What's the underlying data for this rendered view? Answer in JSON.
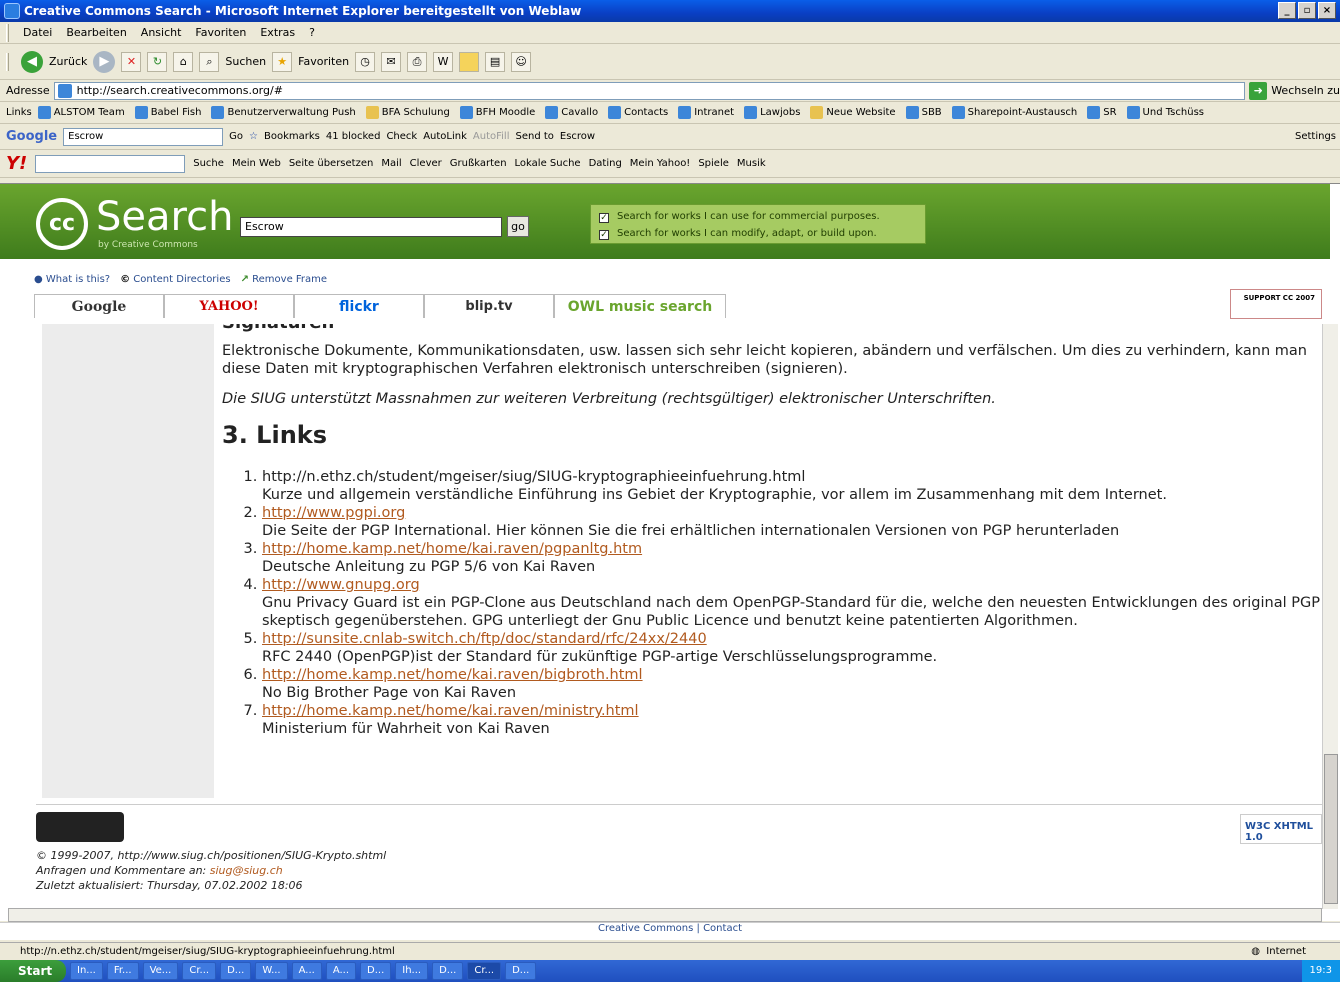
{
  "window": {
    "title": "Creative Commons Search - Microsoft Internet Explorer bereitgestellt von Weblaw"
  },
  "menu": [
    "Datei",
    "Bearbeiten",
    "Ansicht",
    "Favoriten",
    "Extras",
    "?"
  ],
  "toolbar": {
    "back": "Zurück",
    "search": "Suchen",
    "favorites": "Favoriten"
  },
  "address": {
    "label": "Adresse",
    "url": "http://search.creativecommons.org/#",
    "go": "Wechseln zu"
  },
  "links": {
    "label": "Links",
    "items": [
      "ALSTOM Team",
      "Babel Fish",
      "Benutzerverwaltung Push",
      "BFA Schulung",
      "BFH Moodle",
      "Cavallo",
      "Contacts",
      "Intranet",
      "Lawjobs",
      "Neue Website",
      "SBB",
      "Sharepoint-Austausch",
      "SR",
      "Und Tschüss"
    ]
  },
  "google_bar": {
    "brand": "Google",
    "query": "Escrow",
    "go": "Go",
    "bookmarks": "Bookmarks",
    "blocked": "41 blocked",
    "check": "Check",
    "autolink": "AutoLink",
    "autofill": "AutoFill",
    "send": "Send to",
    "escrow": "Escrow",
    "settings": "Settings"
  },
  "yahoo_bar": {
    "suche": "Suche",
    "items": [
      "Mein Web",
      "Seite übersetzen",
      "Mail",
      "Clever",
      "Grußkarten",
      "Lokale Suche",
      "Dating",
      "Mein Yahoo!",
      "Spiele",
      "Musik"
    ]
  },
  "cc": {
    "search_word": "Search",
    "by": "by Creative Commons",
    "query": "Escrow",
    "go": "go",
    "opt1": "Search for works I can use for commercial purposes.",
    "opt2": "Search for works I can modify, adapt, or build upon.",
    "what": "What is this?",
    "directories": "Content Directories",
    "remove": "Remove Frame",
    "tabs": [
      "Google",
      "YAHOO!",
      "flickr",
      "blip.tv",
      "OWL music search"
    ],
    "support": "SUPPORT CC 2007"
  },
  "content": {
    "h3": "Signaturen",
    "p1": "Elektronische Dokumente, Kommunikationsdaten, usw. lassen sich sehr leicht kopieren, abändern und verfälschen. Um dies zu verhindern, kann man diese Daten mit kryptographischen Verfahren elektronisch unterschreiben (signieren).",
    "p2": "Die SIUG unterstützt Massnahmen zur weiteren Verbreitung (rechtsgültiger) elektronischer Unterschriften.",
    "h2": "3. Links",
    "links": [
      {
        "url": "http://n.ethz.ch/student/mgeiser/siug/SIUG-kryptographieeinfuehrung.html",
        "desc": "Kurze und allgemein verständliche Einführung ins Gebiet der Kryptographie, vor allem im Zusammenhang mit dem Internet."
      },
      {
        "url": "http://www.pgpi.org",
        "desc": "Die Seite der PGP International. Hier können Sie die frei erhältlichen internationalen Versionen von PGP herunterladen"
      },
      {
        "url": "http://home.kamp.net/home/kai.raven/pgpanltg.htm",
        "desc": "Deutsche Anleitung zu PGP 5/6 von Kai Raven"
      },
      {
        "url": "http://www.gnupg.org",
        "desc": "Gnu Privacy Guard ist ein PGP-Clone aus Deutschland nach dem OpenPGP-Standard für die, welche den neuesten Entwicklungen des original PGP skeptisch gegenüberstehen. GPG unterliegt der Gnu Public Licence und benutzt keine patentierten Algorithmen."
      },
      {
        "url": "http://sunsite.cnlab-switch.ch/ftp/doc/standard/rfc/24xx/2440",
        "desc": "RFC 2440 (OpenPGP)ist der Standard für zukünftige PGP-artige Verschlüsselungsprogramme."
      },
      {
        "url": "http://home.kamp.net/home/kai.raven/bigbroth.html",
        "desc": "No Big Brother Page von Kai Raven"
      },
      {
        "url": "http://home.kamp.net/home/kai.raven/ministry.html",
        "desc": "Ministerium für Wahrheit von Kai Raven"
      }
    ]
  },
  "footer": {
    "copyright": "© 1999-2007, http://www.siug.ch/positionen/SIUG-Krypto.shtml",
    "contact_prefix": "Anfragen und Kommentare an: ",
    "email": "siug@siug.ch",
    "updated": "Zuletzt aktualisiert: Thursday, 07.02.2002 18:06",
    "w3c": "W3C XHTML 1.0"
  },
  "ccbar": "Creative Commons | Contact",
  "status": {
    "url": "http://n.ethz.ch/student/mgeiser/siug/SIUG-kryptographieeinfuehrung.html",
    "zone": "Internet"
  },
  "taskbar": {
    "start": "Start",
    "tasks": [
      "In...",
      "Fr...",
      "Ve...",
      "Cr...",
      "D...",
      "W...",
      "A...",
      "A...",
      "D...",
      "Ih...",
      "D...",
      "Cr...",
      "D..."
    ],
    "clock": "19:3"
  }
}
